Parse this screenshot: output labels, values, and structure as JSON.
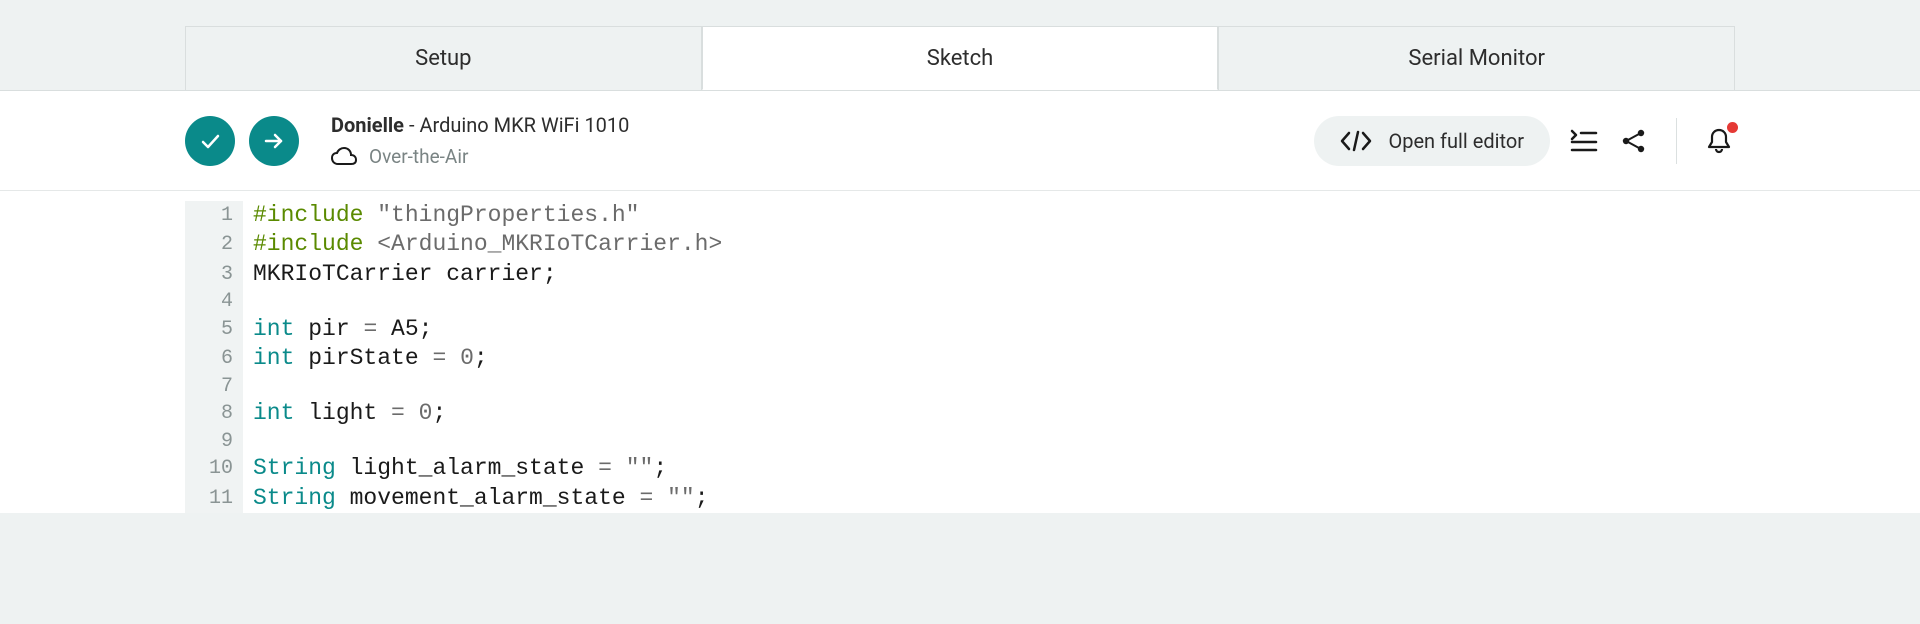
{
  "tabs": {
    "setup": "Setup",
    "sketch": "Sketch",
    "serial_monitor": "Serial Monitor"
  },
  "toolbar": {
    "sketch_name": "Donielle",
    "separator": " - ",
    "board_name": "Arduino MKR WiFi 1010",
    "deployment_method": "Over-the-Air",
    "open_editor_label": "Open full editor"
  },
  "code": {
    "lines": [
      {
        "num": "1",
        "tokens": [
          {
            "cls": "tok-green",
            "text": "#include"
          },
          {
            "cls": "tok-black",
            "text": " "
          },
          {
            "cls": "tok-gray",
            "text": "\"thingProperties.h\""
          }
        ]
      },
      {
        "num": "2",
        "tokens": [
          {
            "cls": "tok-green",
            "text": "#include"
          },
          {
            "cls": "tok-black",
            "text": " "
          },
          {
            "cls": "tok-gray",
            "text": "<Arduino_MKRIoTCarrier.h>"
          }
        ]
      },
      {
        "num": "3",
        "tokens": [
          {
            "cls": "tok-black",
            "text": "MKRIoTCarrier carrier;"
          }
        ]
      },
      {
        "num": "4",
        "tokens": [
          {
            "cls": "tok-black",
            "text": ""
          }
        ]
      },
      {
        "num": "5",
        "tokens": [
          {
            "cls": "tok-teal",
            "text": "int"
          },
          {
            "cls": "tok-black",
            "text": " pir "
          },
          {
            "cls": "tok-gray",
            "text": "="
          },
          {
            "cls": "tok-black",
            "text": " A5;"
          }
        ]
      },
      {
        "num": "6",
        "tokens": [
          {
            "cls": "tok-teal",
            "text": "int"
          },
          {
            "cls": "tok-black",
            "text": " pirState "
          },
          {
            "cls": "tok-gray",
            "text": "="
          },
          {
            "cls": "tok-black",
            "text": " "
          },
          {
            "cls": "tok-gray",
            "text": "0"
          },
          {
            "cls": "tok-black",
            "text": ";"
          }
        ]
      },
      {
        "num": "7",
        "tokens": [
          {
            "cls": "tok-black",
            "text": ""
          }
        ]
      },
      {
        "num": "8",
        "tokens": [
          {
            "cls": "tok-teal",
            "text": "int"
          },
          {
            "cls": "tok-black",
            "text": " light "
          },
          {
            "cls": "tok-gray",
            "text": "="
          },
          {
            "cls": "tok-black",
            "text": " "
          },
          {
            "cls": "tok-gray",
            "text": "0"
          },
          {
            "cls": "tok-black",
            "text": ";"
          }
        ]
      },
      {
        "num": "9",
        "tokens": [
          {
            "cls": "tok-black",
            "text": ""
          }
        ]
      },
      {
        "num": "10",
        "tokens": [
          {
            "cls": "tok-teal",
            "text": "String"
          },
          {
            "cls": "tok-black",
            "text": " light_alarm_state "
          },
          {
            "cls": "tok-gray",
            "text": "="
          },
          {
            "cls": "tok-black",
            "text": " "
          },
          {
            "cls": "tok-gray",
            "text": "\"\""
          },
          {
            "cls": "tok-black",
            "text": ";"
          }
        ]
      },
      {
        "num": "11",
        "tokens": [
          {
            "cls": "tok-teal",
            "text": "String"
          },
          {
            "cls": "tok-black",
            "text": " movement_alarm_state "
          },
          {
            "cls": "tok-gray",
            "text": "="
          },
          {
            "cls": "tok-black",
            "text": " "
          },
          {
            "cls": "tok-gray",
            "text": "\"\""
          },
          {
            "cls": "tok-black",
            "text": ";"
          }
        ]
      }
    ]
  }
}
